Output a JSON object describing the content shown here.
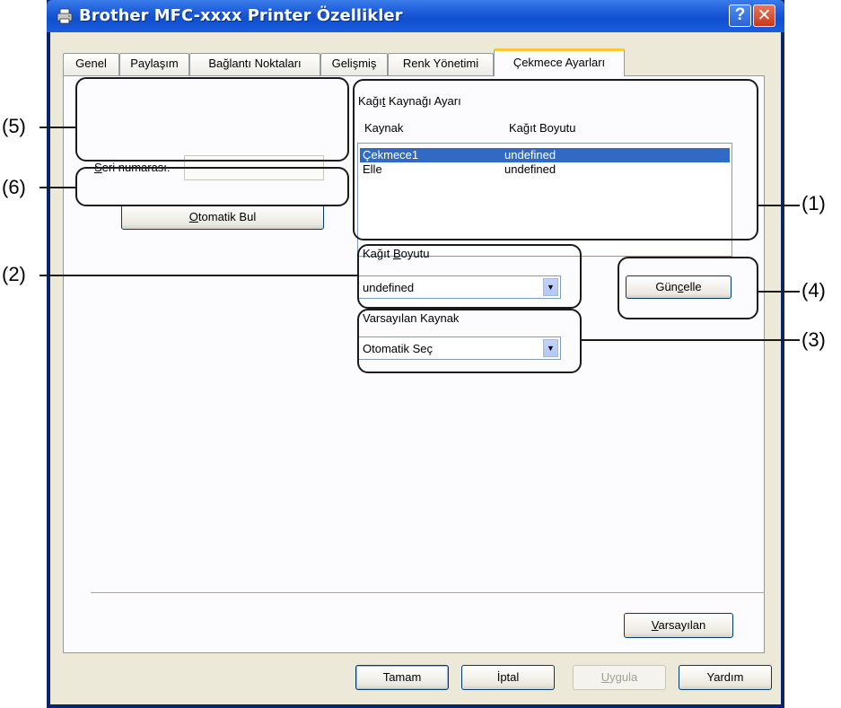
{
  "window": {
    "title": "Brother MFC-xxxx  Printer Özellikler",
    "help_glyph": "?",
    "close_glyph": "✕",
    "title_icon": "printer-icon"
  },
  "tabs": [
    {
      "label": "Genel",
      "active": false
    },
    {
      "label": "Paylaşım",
      "active": false
    },
    {
      "label": "Bağlantı Noktaları",
      "active": false
    },
    {
      "label": "Gelişmiş",
      "active": false
    },
    {
      "label": "Renk Yönetimi",
      "active": false
    },
    {
      "label": "Çekmece Ayarları",
      "active": true
    }
  ],
  "serial": {
    "label_first": "S",
    "label_rest": "eri numarası.",
    "value": ""
  },
  "auto_detect": {
    "label_first": "O",
    "label_rest": "tomatik Bul"
  },
  "paper_source": {
    "group_label_a": "Kağı",
    "group_label_u": "t",
    "group_label_b": " Kaynağı Ayarı",
    "col_source": "Kaynak",
    "col_size": "Kağıt Boyutu",
    "rows": [
      {
        "source": "Çekmece1",
        "size": "undefined",
        "selected": true
      },
      {
        "source": "Elle",
        "size": "undefined",
        "selected": false
      }
    ]
  },
  "paper_size": {
    "label_a": "Kağıt ",
    "label_u": "B",
    "label_b": "oyutu",
    "value": "undefined",
    "arrow": "▼"
  },
  "default_source": {
    "label": "Varsayılan Kaynak",
    "value": "Otomatik Seç",
    "arrow": "▼"
  },
  "update_button": {
    "label_a": "Gün",
    "label_u": "c",
    "label_b": "elle"
  },
  "defaults_button": {
    "label_u": "V",
    "label_rest": "arsayılan"
  },
  "footer": {
    "ok": "Tamam",
    "cancel": "İptal",
    "apply_u": "U",
    "apply_rest": "ygula",
    "help": "Yardım"
  },
  "annotations": [
    "(5)",
    "(6)",
    "(1)",
    "(2)",
    "(4)",
    "(3)"
  ]
}
